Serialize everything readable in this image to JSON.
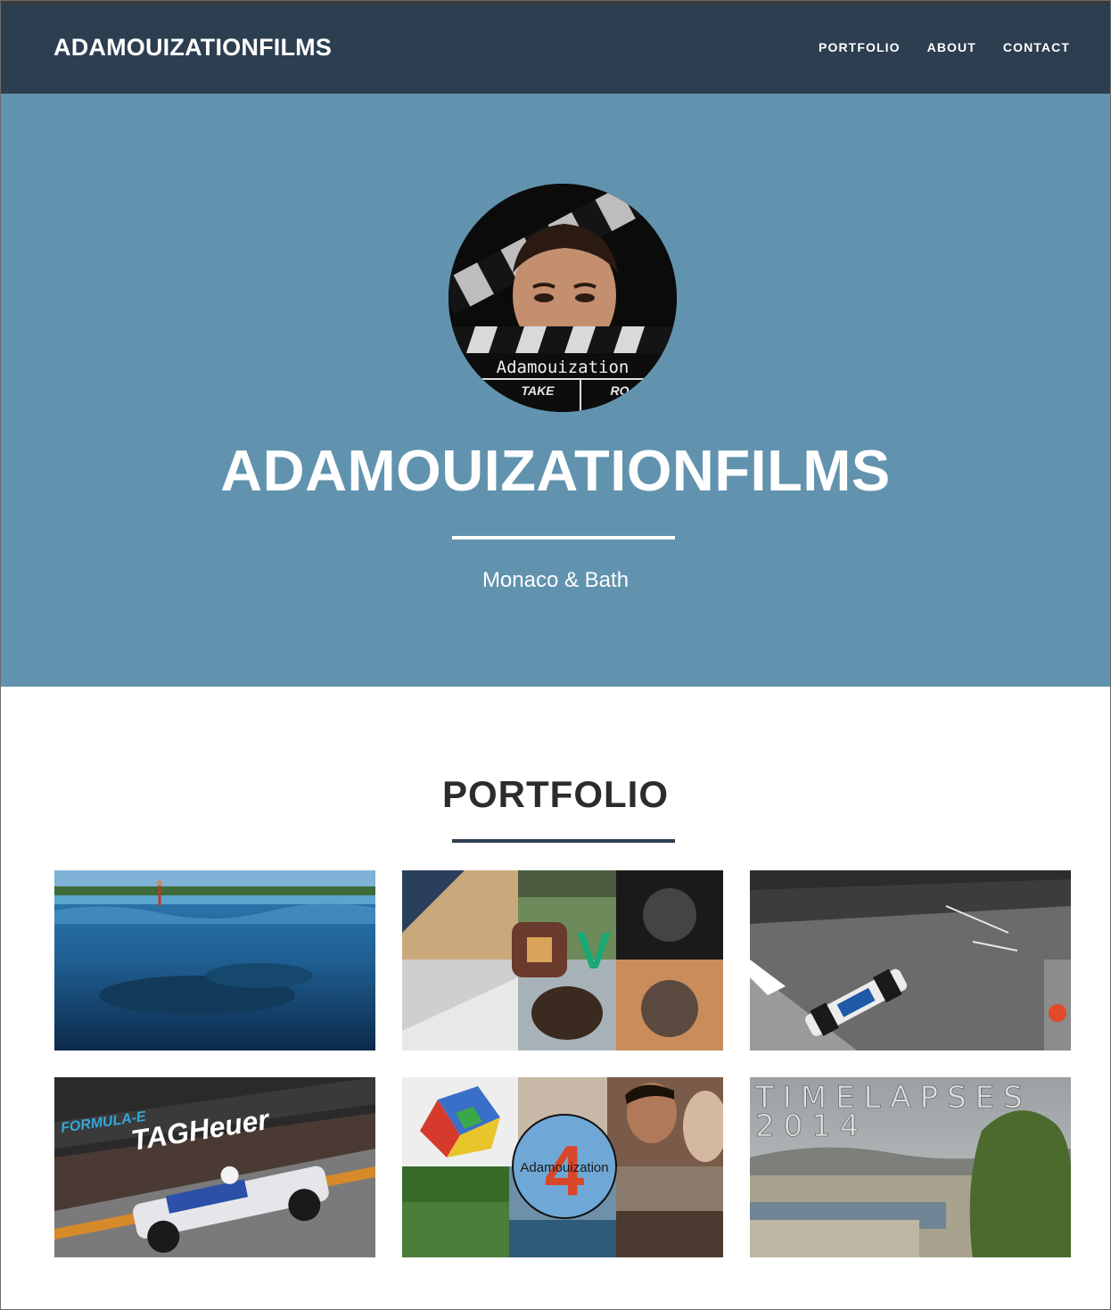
{
  "navbar": {
    "brand": "ADAMOUIZATIONFILMS",
    "links": [
      "PORTFOLIO",
      "ABOUT",
      "CONTACT"
    ]
  },
  "hero": {
    "avatar_text": "Adamouization",
    "avatar_subtext": [
      "TAKE",
      "RO"
    ],
    "title": "ADAMOUIZATIONFILMS",
    "subtitle": "Monaco & Bath"
  },
  "portfolio": {
    "title": "PORTFOLIO",
    "items": [
      {
        "name": "whale-wakeboard"
      },
      {
        "name": "collage-apps"
      },
      {
        "name": "monaco-f1"
      },
      {
        "name": "formula-e",
        "texts": [
          "FORMULA-E",
          "TAGHeuer"
        ]
      },
      {
        "name": "adamouization-4",
        "texts": [
          "Adamouization",
          "4"
        ]
      },
      {
        "name": "timelapses-2014",
        "texts": [
          "TIMELAPSES",
          "2014"
        ]
      }
    ]
  },
  "colors": {
    "navbar": "#2c3e50",
    "hero": "#6193ae",
    "text_dark": "#2c2c2c"
  }
}
